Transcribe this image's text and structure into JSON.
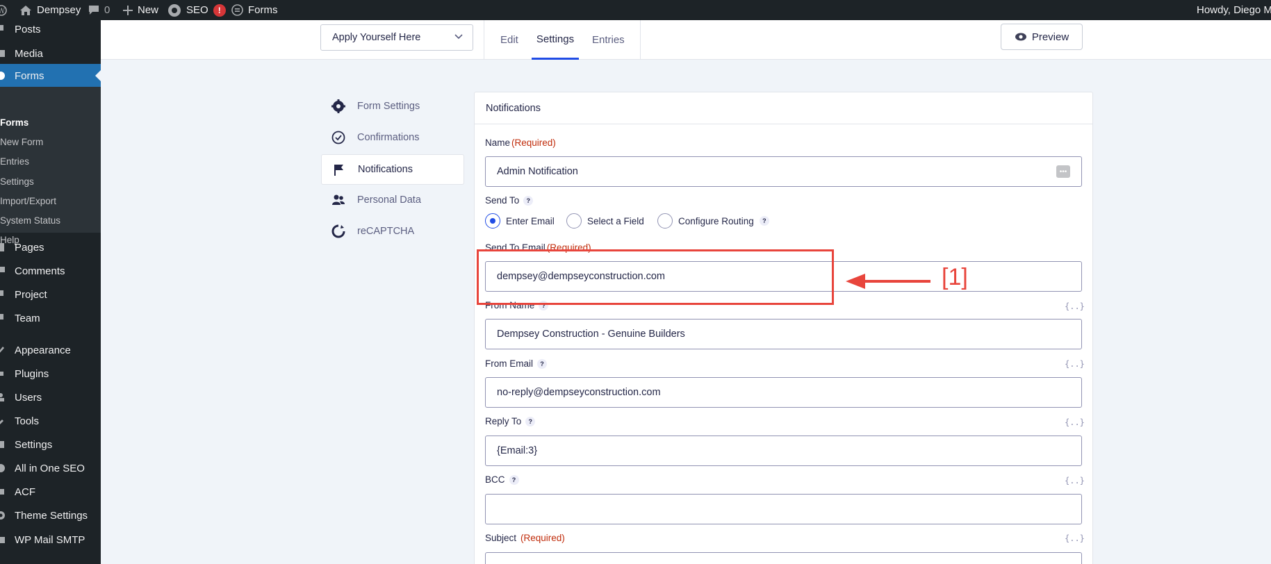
{
  "admin_bar": {
    "site_name": "Dempsey",
    "comments_count": "0",
    "new_label": "New",
    "seo_label": "SEO",
    "seo_badge": "!",
    "forms_label": "Forms",
    "howdy": "Howdy, Diego Mo"
  },
  "sidebar": {
    "items": [
      {
        "label": "Posts",
        "icon": "pin-icon"
      },
      {
        "label": "Media",
        "icon": "media-icon"
      },
      {
        "label": "Forms",
        "icon": "forms-icon"
      },
      {
        "label": "Pages",
        "icon": "page-icon"
      },
      {
        "label": "Comments",
        "icon": "comment-icon"
      },
      {
        "label": "Project",
        "icon": "pin-icon"
      },
      {
        "label": "Team",
        "icon": "pin-icon"
      },
      {
        "label": "Appearance",
        "icon": "brush-icon"
      },
      {
        "label": "Plugins",
        "icon": "plug-icon"
      },
      {
        "label": "Users",
        "icon": "users-icon"
      },
      {
        "label": "Tools",
        "icon": "wrench-icon"
      },
      {
        "label": "Settings",
        "icon": "settings-icon"
      },
      {
        "label": "All in One SEO",
        "icon": "seo-icon"
      },
      {
        "label": "ACF",
        "icon": "acf-icon"
      },
      {
        "label": "Theme Settings",
        "icon": "gear-icon"
      },
      {
        "label": "WP Mail SMTP",
        "icon": "mail-icon"
      }
    ],
    "submenu": [
      "Forms",
      "New Form",
      "Entries",
      "Settings",
      "Import/Export",
      "System Status",
      "Help"
    ]
  },
  "toolbar": {
    "form_select": "Apply Yourself Here",
    "tabs": [
      "Edit",
      "Settings",
      "Entries"
    ],
    "preview_label": "Preview"
  },
  "settings_nav": [
    {
      "label": "Form Settings",
      "icon": "gear-icon"
    },
    {
      "label": "Confirmations",
      "icon": "check-circle-icon"
    },
    {
      "label": "Notifications",
      "icon": "flag-icon"
    },
    {
      "label": "Personal Data",
      "icon": "people-icon"
    },
    {
      "label": "reCAPTCHA",
      "icon": "recaptcha-icon"
    }
  ],
  "panel": {
    "title": "Notifications",
    "required_text": "(Required)",
    "merge_tag": "{..}",
    "help": "?",
    "name_label": "Name",
    "name_value": "Admin Notification",
    "send_to_label": "Send To",
    "send_to_options": [
      "Enter Email",
      "Select a Field",
      "Configure Routing"
    ],
    "send_to_email_label": "Send To Email",
    "send_to_email_value": "dempsey@dempseyconstruction.com",
    "from_name_label": "From Name",
    "from_name_value": "Dempsey Construction - Genuine Builders",
    "from_email_label": "From Email",
    "from_email_value": "no-reply@dempseyconstruction.com",
    "reply_to_label": "Reply To",
    "reply_to_value": "{Email:3}",
    "bcc_label": "BCC",
    "bcc_value": "",
    "subject_label": "Subject"
  },
  "annotation": {
    "label": "[1]",
    "color": "#e8453c"
  }
}
